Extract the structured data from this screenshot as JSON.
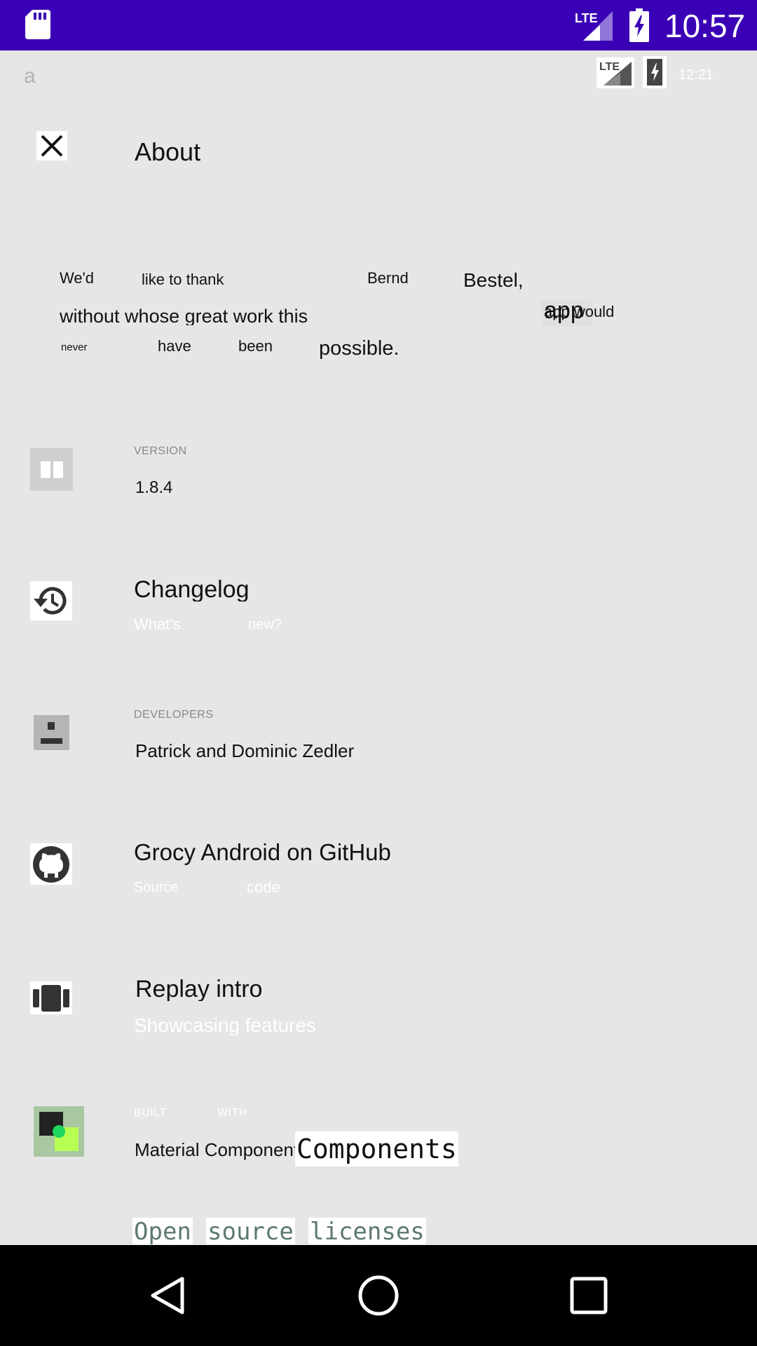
{
  "status_bar": {
    "time": "10:57",
    "network": "LTE"
  },
  "ghost_status": {
    "letter": "a",
    "network": "LTE",
    "time": "12:21"
  },
  "toolbar": {
    "title": "About"
  },
  "thanks": {
    "words": [
      "We'd",
      "like to thank",
      "Bernd",
      "Bestel,",
      "without whose great work this",
      "app",
      "app would",
      "never",
      "have",
      "been",
      "possible."
    ]
  },
  "items": {
    "version": {
      "overline": "VERSION",
      "value": "1.8.4",
      "icon": "version-icon"
    },
    "changelog": {
      "title": "Changelog",
      "sub1": "What's",
      "sub2": "new?",
      "icon": "history-icon"
    },
    "developers": {
      "overline": "DEVELOPERS",
      "value": "Patrick and Dominic Zedler",
      "icon": "developer-icon"
    },
    "github": {
      "title": "Grocy Android on GitHub",
      "sub1": "Source",
      "sub2": "code",
      "icon": "github-icon"
    },
    "intro": {
      "title": "Replay intro",
      "subtitle": "Showcasing features",
      "icon": "carousel-icon"
    },
    "material": {
      "overline1": "BUILT",
      "overline2": "WITH",
      "value": "Material Components",
      "value_overlay": "Components",
      "icon": "material-icon"
    },
    "licenses": {
      "words": [
        "Open",
        "source",
        "licenses"
      ]
    }
  },
  "nav": {
    "back": "back-icon",
    "home": "home-icon",
    "recents": "recents-icon"
  },
  "colors": {
    "status_bar": "#3a00b5",
    "background": "#e6e6e6",
    "license_text": "#5d7a6c"
  }
}
